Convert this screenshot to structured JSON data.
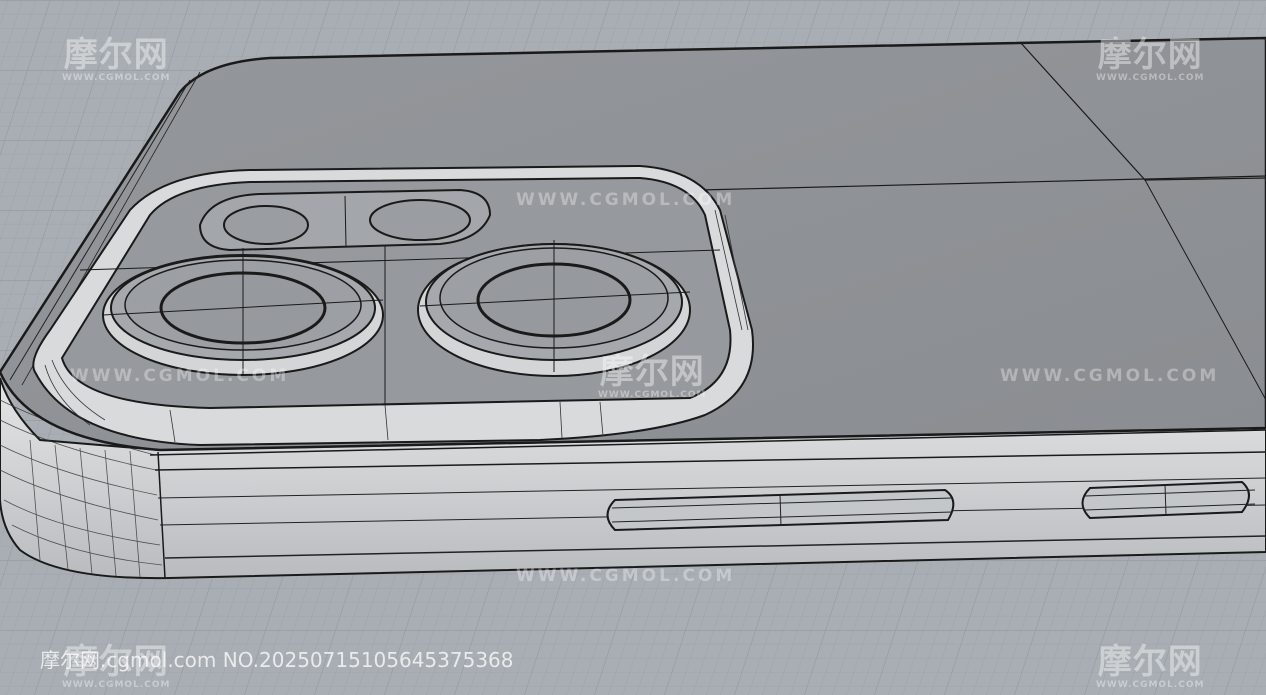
{
  "watermark": {
    "logo_cn": "摩尔网",
    "logo_en": "WWW.CGMOL.COM",
    "url": "WWW.CGMOL.COM",
    "footer_prefix": "摩尔网",
    "footer_site": ".cgmol.com",
    "footer_id": "NO.20250715105645375368"
  },
  "scene": {
    "subject": "phone-back-camera-wireframe",
    "colors": {
      "grid_background": "#a9aeb4",
      "grid_line": "#9ba1a8",
      "phone_back": "#8f9296",
      "camera_plateau": "#96999d",
      "frame": "#cfd1d3",
      "edge_line": "#1a1a1a"
    }
  }
}
